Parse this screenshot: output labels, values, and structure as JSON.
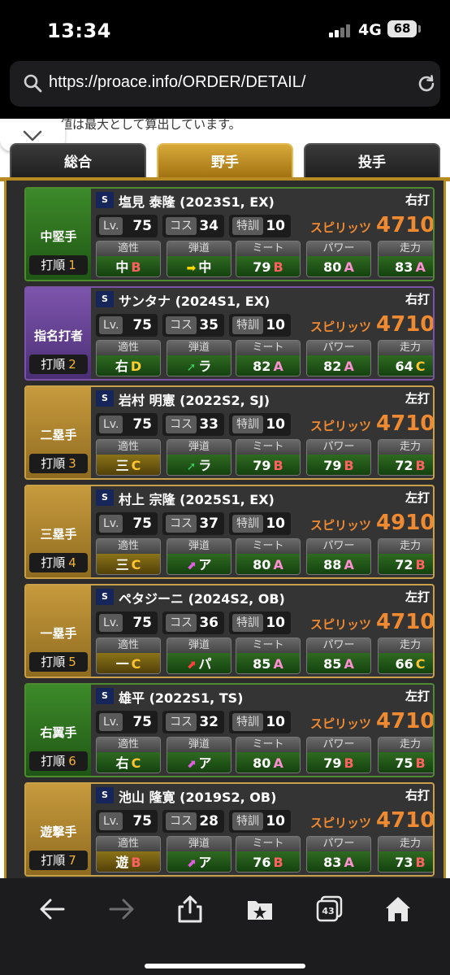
{
  "status_bar": {
    "time": "13:34",
    "network": "4G",
    "battery": "68"
  },
  "url_bar": {
    "url": "https://proace.info/ORDER/DETAIL/"
  },
  "notice": "値は最大として算出しています。",
  "tabs": [
    {
      "label": "総合",
      "active": false
    },
    {
      "label": "野手",
      "active": true
    },
    {
      "label": "投手",
      "active": false
    }
  ],
  "labels": {
    "lv": "Lv.",
    "cost": "コス",
    "training": "特訓",
    "spirits": "スピリッツ",
    "order": "打順",
    "aptitude": "適性",
    "trajectory": "弾道",
    "meet": "ミート",
    "power": "パワー",
    "speed": "走力"
  },
  "players": [
    {
      "position": "中堅手",
      "order": "1",
      "pos_color": "green",
      "name": "塩見 泰隆 (2023S1, EX)",
      "bat": "右打",
      "lv": "75",
      "cost": "34",
      "training": "10",
      "spirits": "4710",
      "apt": "中",
      "apt_rank": "B",
      "apt_style": "green",
      "traj_arrow": "➡",
      "traj_color": "#ffd700",
      "traj": "中",
      "meet": "79",
      "meet_rank": "B",
      "power": "80",
      "power_rank": "A",
      "speed": "83",
      "speed_rank": "A"
    },
    {
      "position": "指名打者",
      "order": "2",
      "pos_color": "purple",
      "name": "サンタナ (2024S1, EX)",
      "bat": "右打",
      "lv": "75",
      "cost": "35",
      "training": "10",
      "spirits": "4710",
      "apt": "右",
      "apt_rank": "D",
      "apt_style": "green",
      "traj_arrow": "➚",
      "traj_color": "#3cd060",
      "traj": "ラ",
      "meet": "82",
      "meet_rank": "A",
      "power": "82",
      "power_rank": "A",
      "speed": "64",
      "speed_rank": "C"
    },
    {
      "position": "二塁手",
      "order": "3",
      "pos_color": "gold",
      "name": "岩村 明憲 (2022S2, SJ)",
      "bat": "左打",
      "lv": "75",
      "cost": "33",
      "training": "10",
      "spirits": "4710",
      "apt": "三",
      "apt_rank": "C",
      "apt_style": "yellow",
      "traj_arrow": "➚",
      "traj_color": "#3cd060",
      "traj": "ラ",
      "meet": "79",
      "meet_rank": "B",
      "power": "79",
      "power_rank": "B",
      "speed": "72",
      "speed_rank": "B"
    },
    {
      "position": "三塁手",
      "order": "4",
      "pos_color": "gold",
      "name": "村上 宗隆 (2025S1, EX)",
      "bat": "左打",
      "lv": "75",
      "cost": "37",
      "training": "10",
      "spirits": "4910",
      "apt": "三",
      "apt_rank": "C",
      "apt_style": "yellow",
      "traj_arrow": "⬈",
      "traj_color": "#e060e0",
      "traj": "ア",
      "meet": "80",
      "meet_rank": "A",
      "power": "88",
      "power_rank": "A",
      "speed": "72",
      "speed_rank": "B"
    },
    {
      "position": "一塁手",
      "order": "5",
      "pos_color": "gold",
      "name": "ペタジーニ (2024S2, OB)",
      "bat": "左打",
      "lv": "75",
      "cost": "36",
      "training": "10",
      "spirits": "4710",
      "apt": "一",
      "apt_rank": "C",
      "apt_style": "yellow",
      "traj_arrow": "⬈",
      "traj_color": "#ff4040",
      "traj": "パ",
      "meet": "85",
      "meet_rank": "A",
      "power": "85",
      "power_rank": "A",
      "speed": "66",
      "speed_rank": "C"
    },
    {
      "position": "右翼手",
      "order": "6",
      "pos_color": "green",
      "name": "雄平 (2022S1, TS)",
      "bat": "左打",
      "lv": "75",
      "cost": "32",
      "training": "10",
      "spirits": "4710",
      "apt": "右",
      "apt_rank": "C",
      "apt_style": "green",
      "traj_arrow": "⬈",
      "traj_color": "#e060e0",
      "traj": "ア",
      "meet": "80",
      "meet_rank": "A",
      "power": "79",
      "power_rank": "B",
      "speed": "75",
      "speed_rank": "B"
    },
    {
      "position": "遊撃手",
      "order": "7",
      "pos_color": "gold",
      "name": "池山 隆寛 (2019S2, OB)",
      "bat": "右打",
      "lv": "75",
      "cost": "28",
      "training": "10",
      "spirits": "4710",
      "apt": "遊",
      "apt_rank": "B",
      "apt_style": "yellow",
      "traj_arrow": "⬈",
      "traj_color": "#e060e0",
      "traj": "ア",
      "meet": "76",
      "meet_rank": "B",
      "power": "83",
      "power_rank": "A",
      "speed": "73",
      "speed_rank": "B"
    }
  ],
  "toolbar": {
    "tabs_count": "43"
  }
}
